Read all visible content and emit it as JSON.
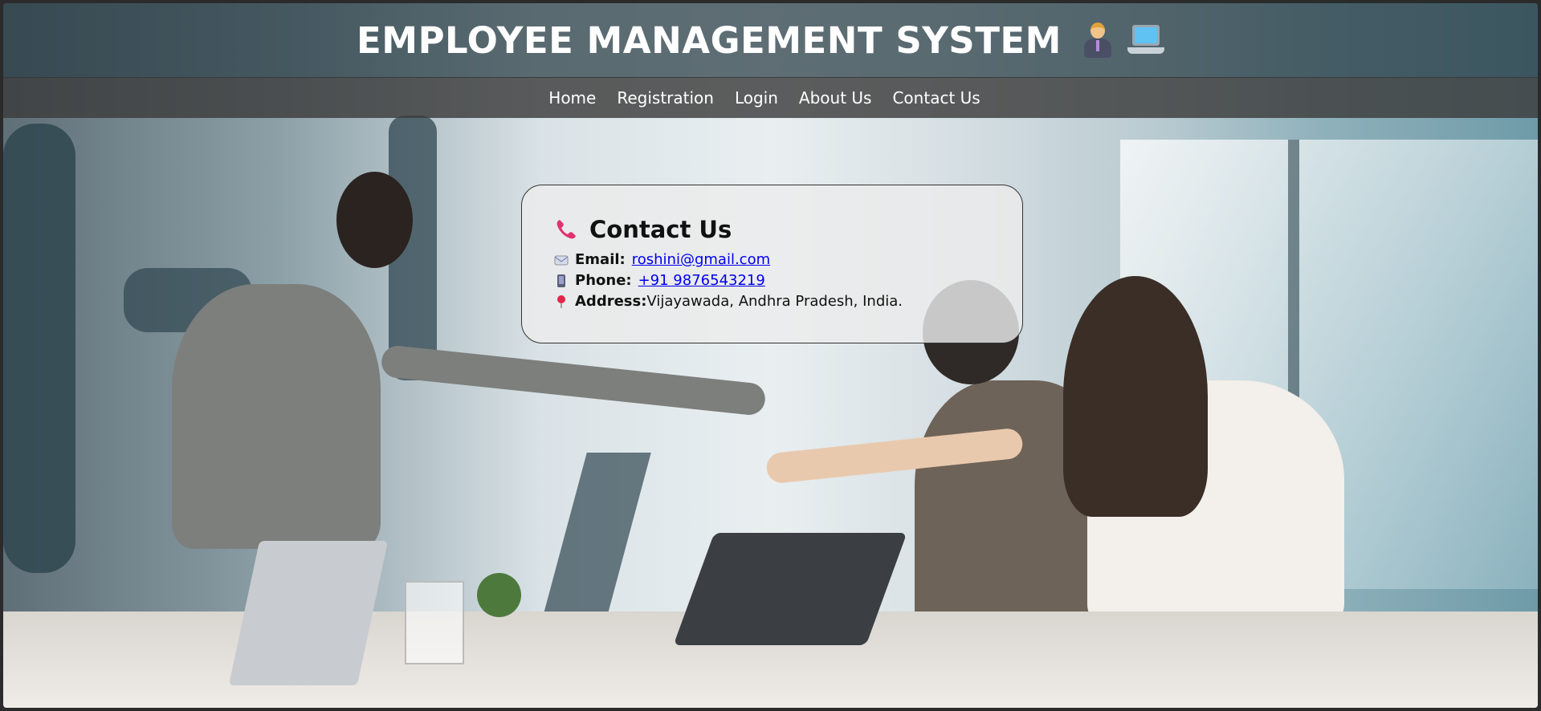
{
  "header": {
    "title": "EMPLOYEE MANAGEMENT SYSTEM",
    "icons": [
      "office-worker-icon",
      "laptop-icon"
    ]
  },
  "nav": {
    "items": [
      {
        "label": "Home"
      },
      {
        "label": "Registration"
      },
      {
        "label": "Login"
      },
      {
        "label": "About Us"
      },
      {
        "label": "Contact Us"
      }
    ]
  },
  "contact": {
    "heading": "Contact Us",
    "heading_icon": "telephone-icon",
    "email_label": "Email:",
    "email_value": "roshini@gmail.com",
    "email_icon": "envelope-icon",
    "phone_label": "Phone:",
    "phone_value": "+91 9876543219",
    "phone_icon": "mobile-phone-icon",
    "address_label": "Address:",
    "address_value": "Vijayawada, Andhra Pradesh, India.",
    "address_icon": "map-pin-icon"
  },
  "colors": {
    "header_bg": "#283c44",
    "nav_bg": "#3c3c3c",
    "link": "#0000ee",
    "card_border": "#333333"
  }
}
